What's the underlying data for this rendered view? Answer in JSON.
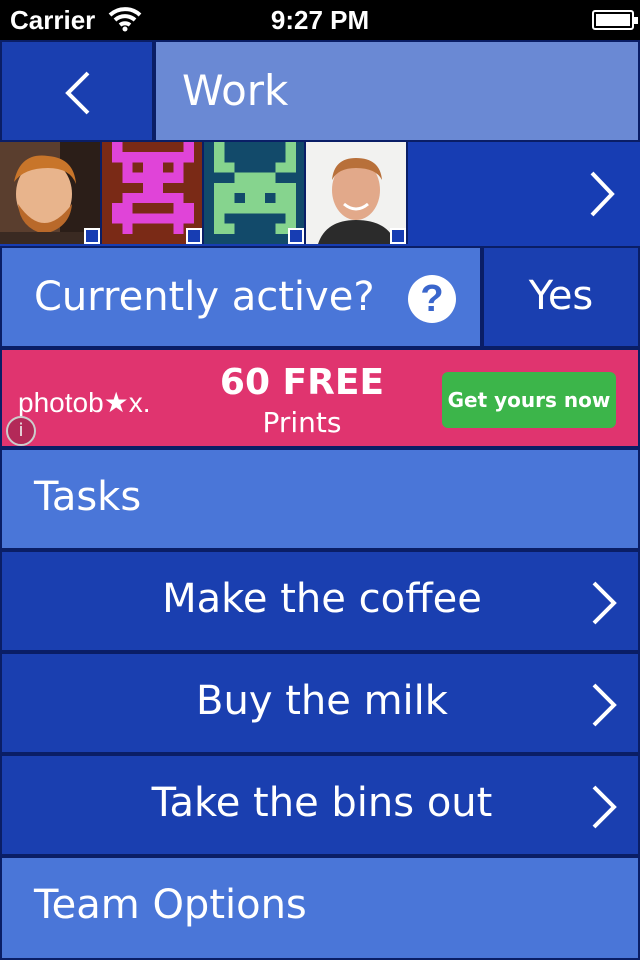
{
  "status_bar": {
    "carrier": "Carrier",
    "time": "9:27 PM"
  },
  "nav": {
    "title": "Work",
    "back_icon": "chevron-left-icon"
  },
  "members": {
    "avatars": [
      "photo-avatar",
      "pixel-robot-avatar",
      "pixel-monster-avatar",
      "photo-avatar"
    ],
    "next_icon": "chevron-right-icon"
  },
  "active": {
    "label": "Currently active?",
    "help_glyph": "?",
    "value": "Yes"
  },
  "ad": {
    "brand": "photob★x.",
    "headline": "60 FREE",
    "subline": "Prints",
    "cta": "Get yours now",
    "info_glyph": "i"
  },
  "tasks": {
    "header": "Tasks",
    "items": [
      {
        "label": "Make the coffee"
      },
      {
        "label": "Buy the milk"
      },
      {
        "label": "Take the bins out"
      }
    ]
  },
  "team_options": {
    "label": "Team Options"
  },
  "colors": {
    "dark_blue": "#1a3fb0",
    "mid_blue": "#4a76d8",
    "light_blue": "#6a89d4",
    "ad_pink": "#e0346f",
    "ad_green": "#3cb54a"
  }
}
